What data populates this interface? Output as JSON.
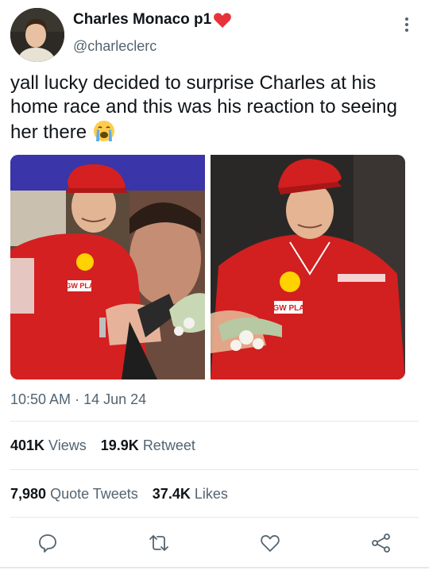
{
  "author": {
    "display_name": "Charles Monaco p1",
    "handle": "@charleclerc"
  },
  "tweet": {
    "text": "yall lucky decided to surprise Charles at his home race and this was his reaction to seeing her there",
    "emoji": "loudly-crying-face-icon",
    "timestamp": "10:50 AM",
    "date": "14 Jun 24"
  },
  "stats": {
    "views_count": "401K",
    "views_label": "Views",
    "retweets_count": "19.9K",
    "retweets_label": "Retweet",
    "quotes_count": "7,980",
    "quotes_label": "Quote Tweets",
    "likes_count": "37.4K",
    "likes_label": "Likes"
  },
  "media": {
    "left_banner_text": "VGW PLAY",
    "right_banner_text": "VGW PLAY"
  },
  "colors": {
    "text": "#0f1419",
    "muted": "#536471",
    "ferrari_red": "#d21f1f"
  }
}
